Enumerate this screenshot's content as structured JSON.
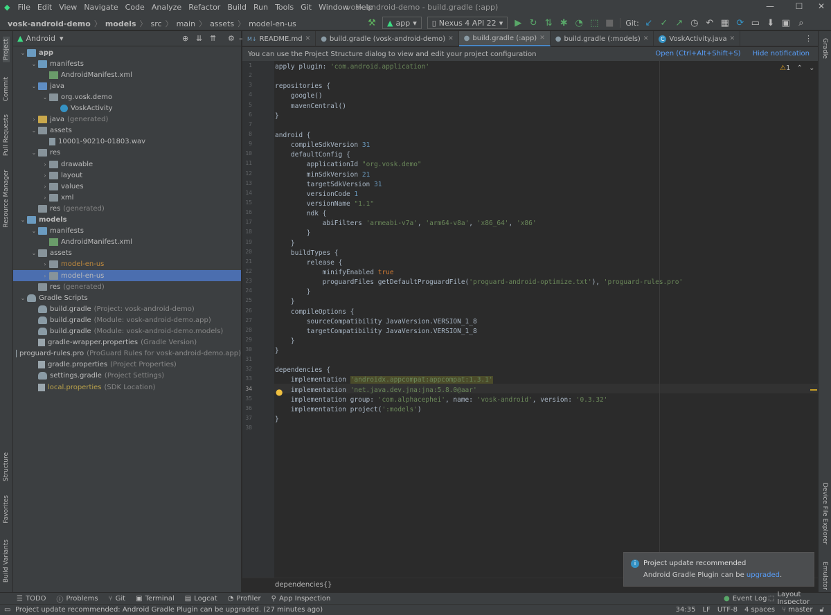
{
  "menu": [
    "File",
    "Edit",
    "View",
    "Navigate",
    "Code",
    "Analyze",
    "Refactor",
    "Build",
    "Run",
    "Tools",
    "Git",
    "Window",
    "Help"
  ],
  "window_title": "vosk-android-demo - build.gradle (:app)",
  "breadcrumb": [
    "vosk-android-demo",
    "models",
    "src",
    "main",
    "assets",
    "model-en-us"
  ],
  "run_config": "app",
  "device": "Nexus 4 API 22",
  "git_label": "Git:",
  "project_view": "Android",
  "left_tabs": [
    "Project",
    "Commit",
    "Pull Requests",
    "Resource Manager",
    "Structure",
    "Favorites",
    "Build Variants"
  ],
  "right_tabs": [
    "Gradle",
    "Device File Explorer",
    "Emulator"
  ],
  "tree": [
    {
      "label": "app",
      "extra": "",
      "depth": 0,
      "icon": "module",
      "open": true
    },
    {
      "label": "manifests",
      "extra": "",
      "depth": 1,
      "icon": "folder-blue",
      "open": true
    },
    {
      "label": "AndroidManifest.xml",
      "extra": "",
      "depth": 2,
      "icon": "manifest",
      "open": null
    },
    {
      "label": "java",
      "extra": "",
      "depth": 1,
      "icon": "folder-src",
      "open": true
    },
    {
      "label": "org.vosk.demo",
      "extra": "",
      "depth": 2,
      "icon": "package",
      "open": true
    },
    {
      "label": "VoskActivity",
      "extra": "",
      "depth": 3,
      "icon": "class",
      "open": null
    },
    {
      "label": "java",
      "extra": "(generated)",
      "depth": 1,
      "icon": "folder-gen",
      "open": false
    },
    {
      "label": "assets",
      "extra": "",
      "depth": 1,
      "icon": "folder",
      "open": true
    },
    {
      "label": "10001-90210-01803.wav",
      "extra": "",
      "depth": 2,
      "icon": "file",
      "open": null
    },
    {
      "label": "res",
      "extra": "",
      "depth": 1,
      "icon": "folder",
      "open": true
    },
    {
      "label": "drawable",
      "extra": "",
      "depth": 2,
      "icon": "folder",
      "open": false
    },
    {
      "label": "layout",
      "extra": "",
      "depth": 2,
      "icon": "folder",
      "open": false
    },
    {
      "label": "values",
      "extra": "",
      "depth": 2,
      "icon": "folder",
      "open": false
    },
    {
      "label": "xml",
      "extra": "",
      "depth": 2,
      "icon": "folder",
      "open": false
    },
    {
      "label": "res",
      "extra": "(generated)",
      "depth": 1,
      "icon": "folder",
      "open": null
    },
    {
      "label": "models",
      "extra": "",
      "depth": 0,
      "icon": "module",
      "open": true
    },
    {
      "label": "manifests",
      "extra": "",
      "depth": 1,
      "icon": "folder-blue",
      "open": true
    },
    {
      "label": "AndroidManifest.xml",
      "extra": "",
      "depth": 2,
      "icon": "manifest",
      "open": null
    },
    {
      "label": "assets",
      "extra": "",
      "depth": 1,
      "icon": "folder",
      "open": true
    },
    {
      "label": "model-en-us",
      "extra": "",
      "depth": 2,
      "icon": "folder",
      "open": false,
      "color": "orange"
    },
    {
      "label": "model-en-us",
      "extra": "",
      "depth": 2,
      "icon": "folder",
      "open": false,
      "selected": true
    },
    {
      "label": "res",
      "extra": "(generated)",
      "depth": 1,
      "icon": "folder",
      "open": null
    },
    {
      "label": "Gradle Scripts",
      "extra": "",
      "depth": 0,
      "icon": "gradle",
      "open": true
    },
    {
      "label": "build.gradle",
      "extra": "(Project: vosk-android-demo)",
      "depth": 1,
      "icon": "gradle",
      "open": null
    },
    {
      "label": "build.gradle",
      "extra": "(Module: vosk-android-demo.app)",
      "depth": 1,
      "icon": "gradle",
      "open": null
    },
    {
      "label": "build.gradle",
      "extra": "(Module: vosk-android-demo.models)",
      "depth": 1,
      "icon": "gradle",
      "open": null
    },
    {
      "label": "gradle-wrapper.properties",
      "extra": "(Gradle Version)",
      "depth": 1,
      "icon": "props",
      "open": null
    },
    {
      "label": "proguard-rules.pro",
      "extra": "(ProGuard Rules for vosk-android-demo.app)",
      "depth": 1,
      "icon": "props",
      "open": null
    },
    {
      "label": "gradle.properties",
      "extra": "(Project Properties)",
      "depth": 1,
      "icon": "props",
      "open": null
    },
    {
      "label": "settings.gradle",
      "extra": "(Project Settings)",
      "depth": 1,
      "icon": "gradle",
      "open": null
    },
    {
      "label": "local.properties",
      "extra": "(SDK Location)",
      "depth": 1,
      "icon": "props",
      "open": null,
      "color": "yellow"
    }
  ],
  "tabs": [
    {
      "label": "README.md",
      "active": false
    },
    {
      "label": "build.gradle (vosk-android-demo)",
      "active": false
    },
    {
      "label": "build.gradle (:app)",
      "active": true
    },
    {
      "label": "build.gradle (:models)",
      "active": false
    },
    {
      "label": "VoskActivity.java",
      "active": false
    }
  ],
  "notification_bar": {
    "text": "You can use the Project Structure dialog to view and edit your project configuration",
    "open": "Open (Ctrl+Alt+Shift+S)",
    "hide": "Hide notification"
  },
  "inspection_count": "1",
  "current_line": "34",
  "code": [
    [
      [
        "t",
        "apply plugin: "
      ],
      [
        "s",
        "'com.android.application'"
      ]
    ],
    [],
    [
      [
        "t",
        "repositories {"
      ]
    ],
    [
      [
        "t",
        "    google()"
      ]
    ],
    [
      [
        "t",
        "    mavenCentral()"
      ]
    ],
    [
      [
        "t",
        "}"
      ]
    ],
    [],
    [
      [
        "t",
        "android {"
      ]
    ],
    [
      [
        "t",
        "    compileSdkVersion "
      ],
      [
        "n",
        "31"
      ]
    ],
    [
      [
        "t",
        "    defaultConfig {"
      ]
    ],
    [
      [
        "t",
        "        applicationId "
      ],
      [
        "s",
        "\"org.vosk.demo\""
      ]
    ],
    [
      [
        "t",
        "        minSdkVersion "
      ],
      [
        "n",
        "21"
      ]
    ],
    [
      [
        "t",
        "        targetSdkVersion "
      ],
      [
        "n",
        "31"
      ]
    ],
    [
      [
        "t",
        "        versionCode "
      ],
      [
        "n",
        "1"
      ]
    ],
    [
      [
        "t",
        "        versionName "
      ],
      [
        "s",
        "\"1.1\""
      ]
    ],
    [
      [
        "t",
        "        ndk {"
      ]
    ],
    [
      [
        "t",
        "            abiFilters "
      ],
      [
        "s",
        "'armeabi-v7a'"
      ],
      [
        "t",
        ", "
      ],
      [
        "s",
        "'arm64-v8a'"
      ],
      [
        "t",
        ", "
      ],
      [
        "s",
        "'x86_64'"
      ],
      [
        "t",
        ", "
      ],
      [
        "s",
        "'x86'"
      ]
    ],
    [
      [
        "t",
        "        }"
      ]
    ],
    [
      [
        "t",
        "    }"
      ]
    ],
    [
      [
        "t",
        "    buildTypes {"
      ]
    ],
    [
      [
        "t",
        "        release {"
      ]
    ],
    [
      [
        "t",
        "            minifyEnabled "
      ],
      [
        "k",
        "true"
      ]
    ],
    [
      [
        "t",
        "            proguardFiles getDefaultProguardFile("
      ],
      [
        "s",
        "'proguard-android-optimize.txt'"
      ],
      [
        "t",
        "), "
      ],
      [
        "s",
        "'proguard-rules.pro'"
      ]
    ],
    [
      [
        "t",
        "        }"
      ]
    ],
    [
      [
        "t",
        "    }"
      ]
    ],
    [
      [
        "t",
        "    compileOptions {"
      ]
    ],
    [
      [
        "t",
        "        sourceCompatibility JavaVersion.VERSION_1_8"
      ]
    ],
    [
      [
        "t",
        "        targetCompatibility JavaVersion.VERSION_1_8"
      ]
    ],
    [
      [
        "t",
        "    }"
      ]
    ],
    [
      [
        "t",
        "}"
      ]
    ],
    [],
    [
      [
        "t",
        "dependencies {"
      ]
    ],
    [
      [
        "t",
        "    implementation "
      ],
      [
        "h",
        "'androidx.appcompat:appcompat:1.3.1'"
      ]
    ],
    [
      [
        "t",
        "    implementation "
      ],
      [
        "s",
        "'net.java.dev.jna:jna:5.8.0@aar'"
      ]
    ],
    [
      [
        "t",
        "    implementation group: "
      ],
      [
        "s",
        "'com.alphacephei'"
      ],
      [
        "t",
        ", name: "
      ],
      [
        "s",
        "'vosk-android'"
      ],
      [
        "t",
        ", version: "
      ],
      [
        "s",
        "'0.3.32'"
      ]
    ],
    [
      [
        "t",
        "    implementation project("
      ],
      [
        "s",
        "':models'"
      ],
      [
        "t",
        ")"
      ]
    ],
    [
      [
        "t",
        "}"
      ]
    ],
    []
  ],
  "editor_breadcrumb": "dependencies{}",
  "toast": {
    "title": "Project update recommended",
    "body": "Android Gradle Plugin can be ",
    "link": "upgraded",
    "end": "."
  },
  "bottom_tools": [
    "TODO",
    "Problems",
    "Git",
    "Terminal",
    "Logcat",
    "Profiler",
    "App Inspection"
  ],
  "bottom_right_tools": [
    "Event Log",
    "Layout Inspector"
  ],
  "status": {
    "message": "Project update recommended: Android Gradle Plugin can be upgraded. (27 minutes ago)",
    "position": "34:35",
    "line_sep": "LF",
    "encoding": "UTF-8",
    "indent": "4 spaces",
    "branch": "master"
  }
}
